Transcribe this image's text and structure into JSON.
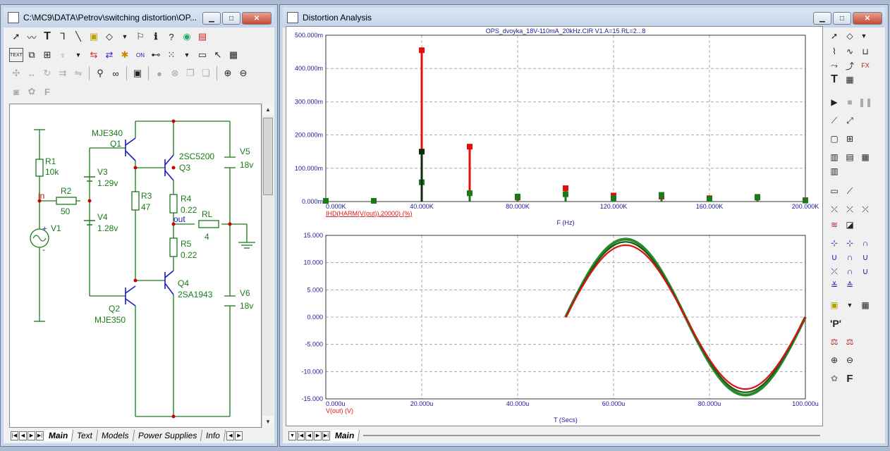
{
  "schematic_window": {
    "title": "C:\\MC9\\DATA\\Petrov\\switching distortion\\OP...",
    "tabs": [
      "Main",
      "Text",
      "Models",
      "Power Supplies",
      "Info"
    ],
    "components": {
      "r1": {
        "name": "R1",
        "value": "10k"
      },
      "r2": {
        "name": "R2",
        "value": "50"
      },
      "r3": {
        "name": "R3",
        "value": "47"
      },
      "r4": {
        "name": "R4",
        "value": "0.22"
      },
      "r5": {
        "name": "R5",
        "value": "0.22"
      },
      "rl": {
        "name": "RL",
        "value": "4"
      },
      "v1": {
        "name": "V1"
      },
      "v3": {
        "name": "V3",
        "value": "1.29v"
      },
      "v4": {
        "name": "V4",
        "value": "1.28v"
      },
      "v5": {
        "name": "V5",
        "value": "18v"
      },
      "v6": {
        "name": "V6",
        "value": "18v"
      },
      "q1": {
        "name": "Q1",
        "model": "MJE340"
      },
      "q2": {
        "name": "Q2",
        "model": "MJE350"
      },
      "q3": {
        "name": "Q3",
        "model": "2SC5200"
      },
      "q4": {
        "name": "Q4",
        "model": "2SA1943"
      },
      "node_in": "in",
      "node_out": "out",
      "plus": "+",
      "minus": "-"
    }
  },
  "analysis_window": {
    "title": "Distortion Analysis",
    "tab": "Main"
  },
  "chart_data": [
    {
      "type": "bar",
      "title": "OPS_dvoyka_18V-110mA_20kHz.CIR V1.A=15 RL=2...8",
      "xlabel": "F (Hz)",
      "ylabel": "IHD(HARM(V(out)),20000) (%)",
      "xlim": [
        0,
        200000
      ],
      "ylim": [
        0,
        500
      ],
      "x_ticks": [
        "0.000K",
        "40.000K",
        "80.000K",
        "120.000K",
        "160.000K",
        "200.000K"
      ],
      "y_ticks": [
        "0.000m",
        "100.000m",
        "200.000m",
        "300.000m",
        "400.000m",
        "500.000m"
      ],
      "series": [
        {
          "color": "#e01010",
          "x": [
            40000,
            60000,
            80000,
            100000,
            120000,
            140000,
            160000,
            180000,
            200000
          ],
          "values": [
            455,
            165,
            12,
            40,
            18,
            15,
            10,
            12,
            4
          ]
        },
        {
          "color": "#1a7a1a",
          "x": [
            0,
            20000,
            40000,
            60000,
            80000,
            100000,
            120000,
            140000,
            160000,
            180000,
            200000
          ],
          "values": [
            2,
            2,
            58,
            25,
            15,
            22,
            10,
            20,
            8,
            14,
            3
          ]
        },
        {
          "color": "#102a10",
          "x": [
            40000
          ],
          "values": [
            150
          ]
        }
      ]
    },
    {
      "type": "line",
      "xlabel": "T (Secs)",
      "ylabel": "V(out) (V)",
      "xlim": [
        0,
        100
      ],
      "ylim": [
        -15,
        15
      ],
      "x_ticks": [
        "0.000u",
        "20.000u",
        "40.000u",
        "60.000u",
        "80.000u",
        "100.000u"
      ],
      "y_ticks": [
        "15.000",
        "10.000",
        "5.000",
        "0.000",
        "-5.000",
        "-10.000",
        "-15.000"
      ],
      "series": [
        {
          "color": "#2a8a2a",
          "amplitude": 14.3,
          "t_start": 50,
          "t_end": 100
        },
        {
          "color": "#1a5a1a",
          "amplitude": 13.8,
          "t_start": 50,
          "t_end": 100
        },
        {
          "color": "#dd1111",
          "amplitude": 13.2,
          "t_start": 50,
          "t_end": 100
        }
      ]
    }
  ]
}
